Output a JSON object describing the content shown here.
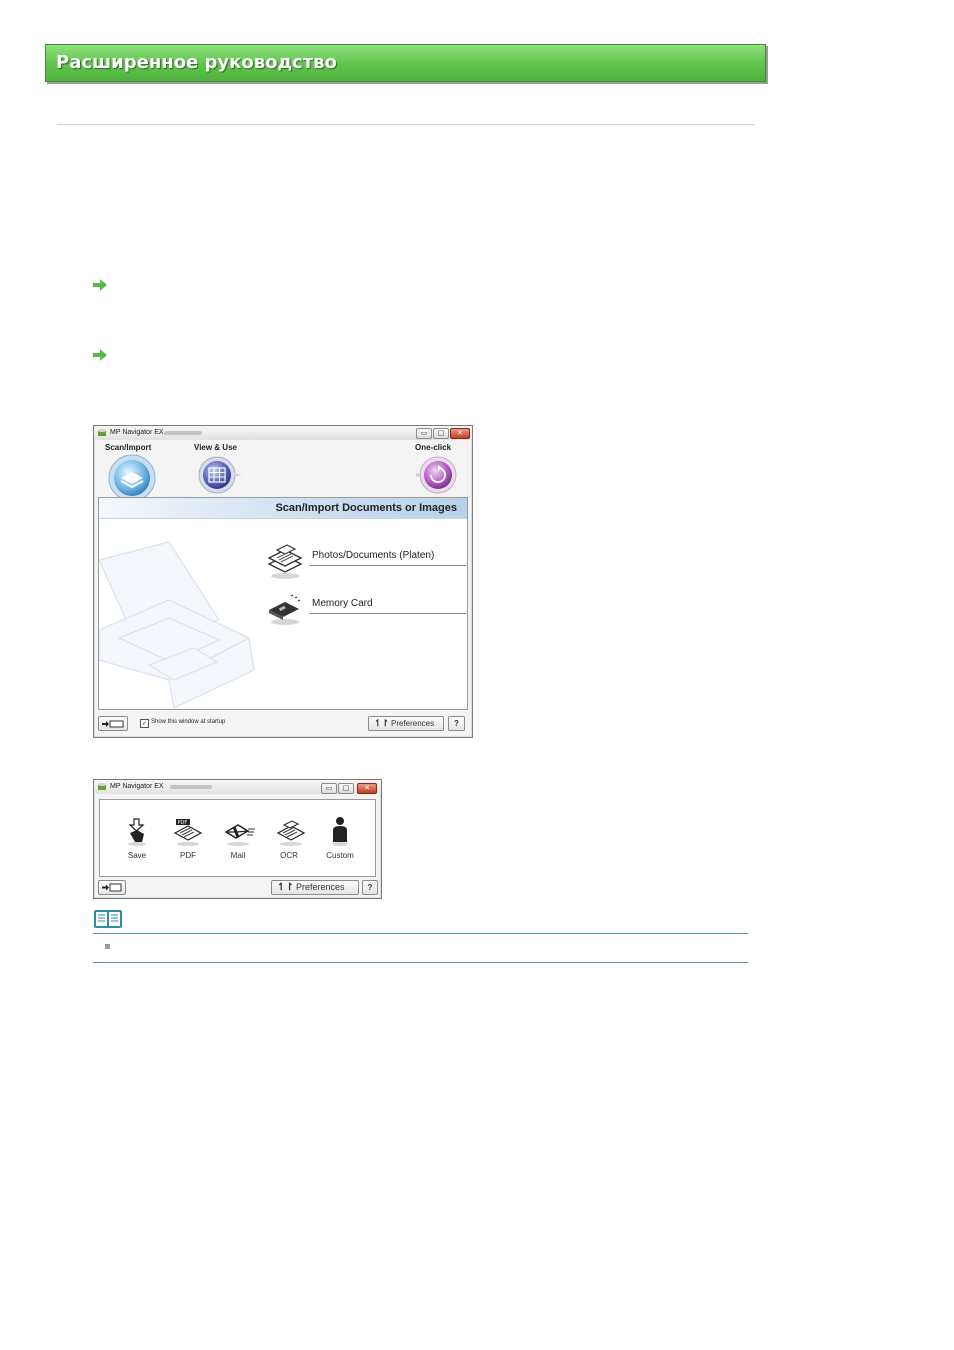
{
  "header": {
    "title": "Расширенное руководство"
  },
  "big_window": {
    "title": "MP Navigator EX",
    "tabs": [
      {
        "label": "Scan/Import"
      },
      {
        "label": "View & Use"
      },
      {
        "label": "One-click"
      }
    ],
    "panel_title": "Scan/Import Documents or Images",
    "items": [
      {
        "label": "Photos/Documents (Platen)",
        "icon": "scan-documents-icon"
      },
      {
        "label": "Memory Card",
        "icon": "memory-card-icon"
      }
    ],
    "show_at_startup_label": "Show this window at startup",
    "show_at_startup_checked": true,
    "preferences_label": "Preferences",
    "help_label": "?"
  },
  "small_window": {
    "title": "MP Navigator EX",
    "tools": [
      {
        "label": "Save",
        "icon": "save-icon"
      },
      {
        "label": "PDF",
        "icon": "pdf-icon"
      },
      {
        "label": "Mail",
        "icon": "mail-icon"
      },
      {
        "label": "OCR",
        "icon": "ocr-icon"
      },
      {
        "label": "Custom",
        "icon": "custom-icon"
      }
    ],
    "preferences_label": "Preferences",
    "help_label": "?"
  },
  "window_buttons": {
    "minimize": "▭",
    "maximize": "□",
    "close": "✕"
  },
  "colors": {
    "banner": "#5fc34c",
    "note_line": "#4a9aa6",
    "arrow": "#56b947"
  }
}
